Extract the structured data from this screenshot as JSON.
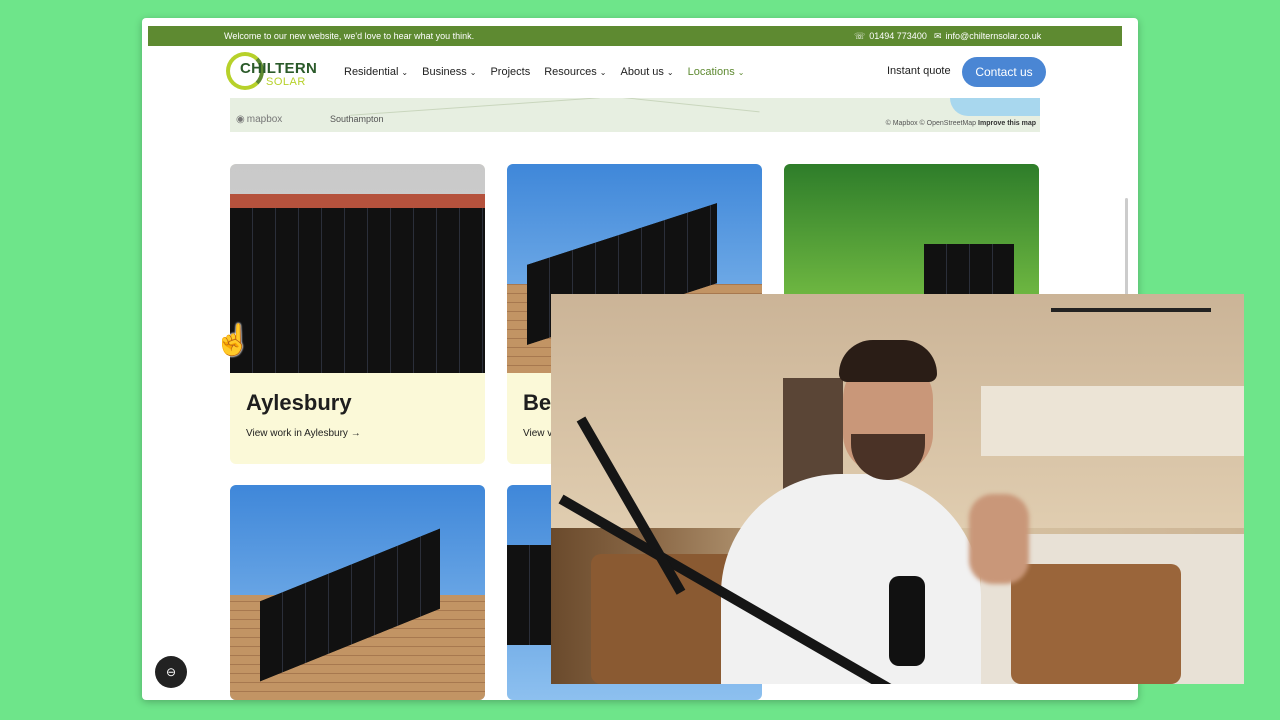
{
  "topbar": {
    "welcome": "Welcome to our new website, we'd love to hear what you think.",
    "phone": "01494 773400",
    "email": "info@chilternsolar.co.uk"
  },
  "logo": {
    "line1": "CHILTERN",
    "line2": "SOLAR"
  },
  "nav": {
    "items": [
      {
        "label": "Residential",
        "has_dropdown": true
      },
      {
        "label": "Business",
        "has_dropdown": true
      },
      {
        "label": "Projects",
        "has_dropdown": false
      },
      {
        "label": "Resources",
        "has_dropdown": true
      },
      {
        "label": "About us",
        "has_dropdown": true
      },
      {
        "label": "Locations",
        "has_dropdown": true,
        "active": true
      }
    ],
    "instant_quote": "Instant quote",
    "contact": "Contact us"
  },
  "map": {
    "provider": "mapbox",
    "city": "Southampton",
    "attribution": "© Mapbox © OpenStreetMap",
    "improve": "Improve this map"
  },
  "cards": [
    {
      "title": "Aylesbury",
      "link": "View work in Aylesbury"
    },
    {
      "title": "Be",
      "link": "View v"
    }
  ],
  "colors": {
    "brand_green": "#5e8a31",
    "accent_blue": "#4a86d4",
    "card_bg": "#fbf9d8",
    "page_bg": "#6ee58a"
  },
  "icons": {
    "phone": "phone-icon",
    "email": "mail-icon",
    "chat": "chat-icon",
    "cursor": "hand-cursor-icon"
  }
}
